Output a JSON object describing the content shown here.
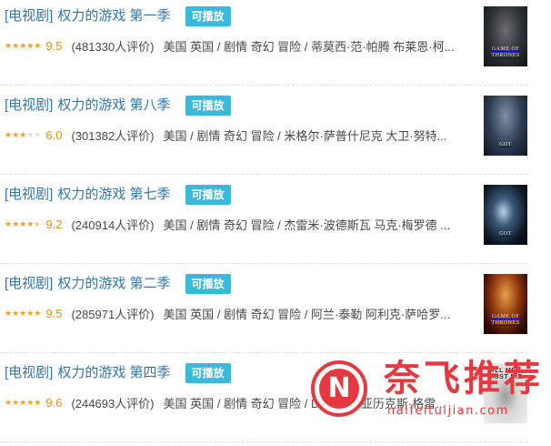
{
  "results": [
    {
      "category": "[电视剧]",
      "title": "权力的游戏 第一季",
      "playable": "可播放",
      "stars": 5,
      "rating": "9.5",
      "votes": "(481330人评价)",
      "meta": "美国 英国 / 剧情 奇幻 冒险 / 蒂莫西·范·帕腾 布莱恩·柯...",
      "poster_text": "GAME OF THRONES"
    },
    {
      "category": "[电视剧]",
      "title": "权力的游戏 第八季",
      "playable": "可播放",
      "stars": 3,
      "rating": "6.0",
      "votes": "(301382人评价)",
      "meta": "美国 / 剧情 奇幻 冒险 / 米格尔·萨普什尼克 大卫·努特...",
      "poster_text": "GOT"
    },
    {
      "category": "[电视剧]",
      "title": "权力的游戏 第七季",
      "playable": "可播放",
      "stars": 4.5,
      "rating": "9.2",
      "votes": "(240914人评价)",
      "meta": "美国 / 剧情 奇幻 冒险 / 杰雷米·波德斯瓦 马克·梅罗德 ...",
      "poster_text": "GOT"
    },
    {
      "category": "[电视剧]",
      "title": "权力的游戏 第二季",
      "playable": "可播放",
      "stars": 5,
      "rating": "9.5",
      "votes": "(285971人评价)",
      "meta": "美国 英国 / 剧情 奇幻 冒险 / 阿兰·泰勒 阿利克·萨哈罗...",
      "poster_text": "GAME OF THRONES"
    },
    {
      "category": "[电视剧]",
      "title": "权力的游戏 第四季",
      "playable": "可播放",
      "stars": 5,
      "rating": "9.6",
      "votes": "(244693人评价)",
      "meta": "美国 英国 / 剧情 奇幻 冒险 / D.B.威斯 亚历克斯·格雷...",
      "poster_text": "ALL MEN MUST DIE"
    }
  ],
  "colors": {
    "link": "#3377aa",
    "badge": "#3bb9da",
    "star": "#f7a000",
    "rating": "#e09015",
    "watermark": "#e5393f"
  },
  "watermark": {
    "logo_letter": "N",
    "title": "奈飞推荐",
    "url": "naifeituijian.com"
  }
}
